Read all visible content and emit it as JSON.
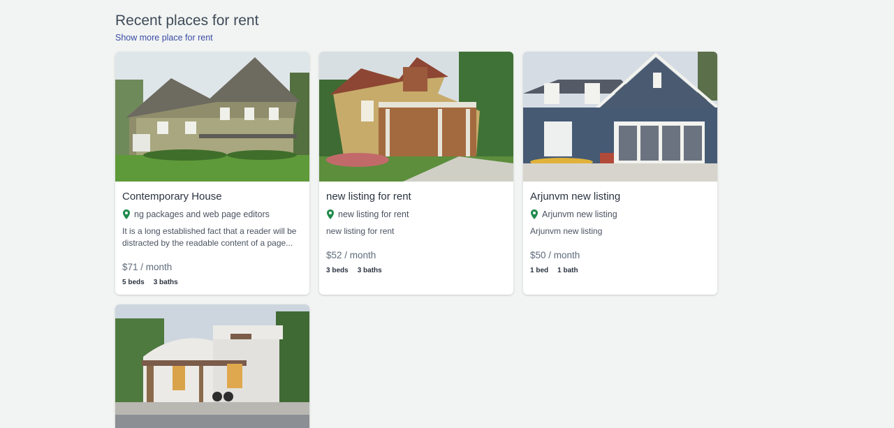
{
  "section": {
    "title": "Recent places for rent",
    "show_more": "Show more place for rent"
  },
  "listings": [
    {
      "title": "Contemporary House",
      "location": "ng packages and web page editors",
      "description": "It is a long established fact that a reader will be distracted by the readable content of a page...",
      "price": "$71 / month",
      "beds": "5 beds",
      "baths": "3 baths"
    },
    {
      "title": "new listing for rent",
      "location": "new listing for rent",
      "description": "new listing for rent",
      "price": "$52 / month",
      "beds": "3 beds",
      "baths": "3 baths"
    },
    {
      "title": "Arjunvm new listing",
      "location": "Arjunvm new listing",
      "description": "Arjunvm new listing",
      "price": "$50 / month",
      "beds": "1 bed",
      "baths": "1 bath"
    },
    {
      "title": "",
      "location": "",
      "description": "",
      "price": "",
      "beds": "",
      "baths": ""
    }
  ],
  "icons": {
    "location": "map-pin-icon"
  },
  "colors": {
    "pin": "#1f8a4c",
    "link": "#3b4ba6",
    "background": "#f1f4f2"
  }
}
